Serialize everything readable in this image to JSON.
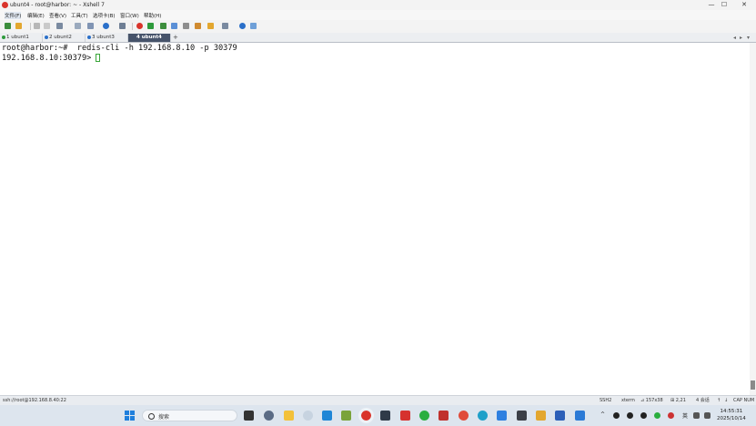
{
  "window": {
    "title": "ubunt4 - root@harbor: ~ - Xshell 7",
    "controls": [
      "—",
      "☐",
      "✕"
    ]
  },
  "menu": [
    "文件(F)",
    "编辑(E)",
    "查看(V)",
    "工具(T)",
    "选项卡(B)",
    "窗口(W)",
    "帮助(H)"
  ],
  "tabs": [
    {
      "label": "1 ubunt1",
      "dot_color": "#2e9a3c"
    },
    {
      "label": "2 ubunt2",
      "dot_color": "#2a6fc9"
    },
    {
      "label": "3 ubunt3",
      "dot_color": "#2a6fc9"
    },
    {
      "label": "4 ubunt4",
      "active": true
    }
  ],
  "tab_add": "+",
  "tab_nav": [
    "◂",
    "▸",
    "▾"
  ],
  "terminal": {
    "lines": [
      "root@harbor:~#  redis-cli -h 192.168.8.10 -p 30379",
      "192.168.8.10:30379> "
    ]
  },
  "status": {
    "connection": "ssh://root@192.168.8.40:22",
    "protocol": "SSH2",
    "term": "xterm",
    "size": "⊿ 157x38",
    "position": "⊞ 2,21",
    "sessions": "4 会话",
    "keys": "CAP NUM"
  },
  "taskbar": {
    "search_placeholder": "搜索",
    "ime": "英",
    "time": "14:55:31",
    "date": "2025/10/14"
  },
  "colors": {
    "accent": "#46536a",
    "cursor": "#3aa63a",
    "titlebar": "#f3f3f3"
  }
}
